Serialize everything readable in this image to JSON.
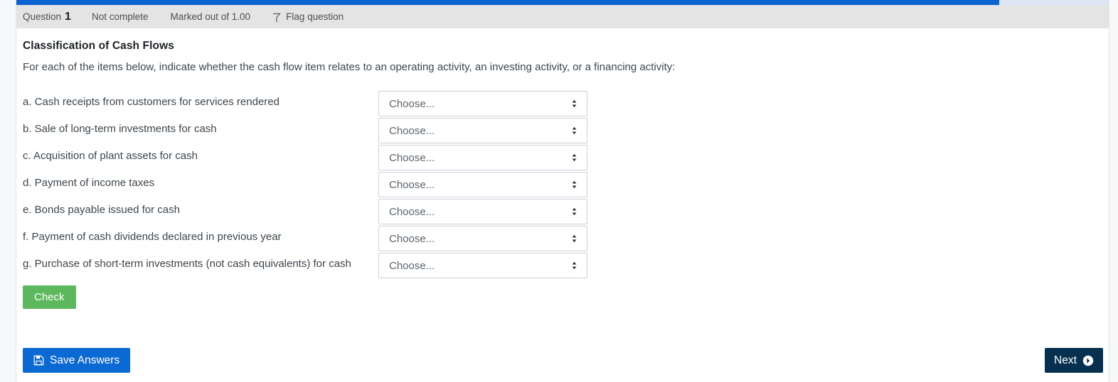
{
  "progress": {
    "percent": 90,
    "fill_color": "#0b62d1",
    "track_color": "#dde6f5"
  },
  "question_header": {
    "question_word": "Question",
    "question_number": "1",
    "state": "Not complete",
    "marks": "Marked out of 1.00",
    "flag_label": "Flag question",
    "flag_icon": "flag-icon"
  },
  "question": {
    "title": "Classification of Cash Flows",
    "intro": "For each of the items below, indicate whether the cash flow item relates to an operating activity, an investing activity, or a financing activity:",
    "items": [
      {
        "label": "a. Cash receipts from customers for services rendered",
        "selected": "Choose..."
      },
      {
        "label": "b. Sale of long-term investments for cash",
        "selected": "Choose..."
      },
      {
        "label": "c. Acquisition of plant assets for cash",
        "selected": "Choose..."
      },
      {
        "label": "d. Payment of income taxes",
        "selected": "Choose..."
      },
      {
        "label": "e. Bonds payable issued for cash",
        "selected": "Choose..."
      },
      {
        "label": "f. Payment of cash dividends declared in previous year",
        "selected": "Choose..."
      },
      {
        "label": "g. Purchase of short-term investments (not cash equivalents) for cash",
        "selected": "Choose..."
      }
    ],
    "check_label": "Check",
    "check_color": "#5cb85c"
  },
  "footer": {
    "save_label": "Save Answers",
    "save_icon": "save-floppy-icon",
    "save_color": "#0b69d4",
    "next_label": "Next",
    "next_icon": "arrow-circle-right-icon",
    "next_color": "#06304f"
  }
}
